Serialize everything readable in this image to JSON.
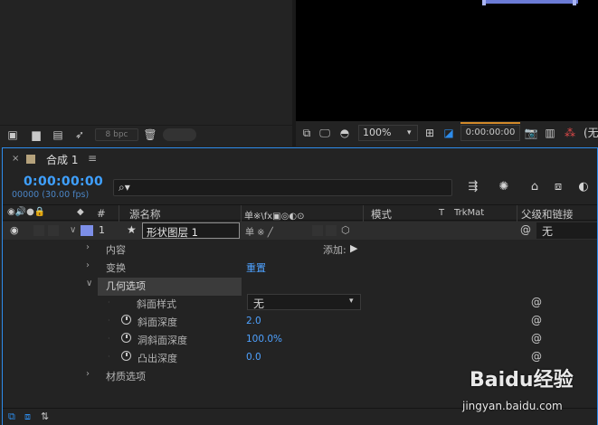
{
  "project_panel": {
    "bpc_label": "8 bpc"
  },
  "viewer_toolbar": {
    "zoom_value": "100%",
    "timecode": "0:00:00:00",
    "overflow_label": "(无"
  },
  "timeline": {
    "tab_title": "合成 1",
    "timecode": "0:00:00:00",
    "frames": "00000 (30.00 fps)",
    "search_placeholder": "",
    "columns": {
      "number": "#",
      "source_name": "源名称",
      "switches": "单※\\fx▣◎◐⊙",
      "mode": "模式",
      "t": "T",
      "trkmat": "TrkMat",
      "parent": "父级和链接"
    },
    "layer": {
      "index": "1",
      "name": "形状图层 1",
      "parent_value": "无"
    },
    "rows": {
      "content": "内容",
      "add_label": "添加:",
      "transform": "变换",
      "transform_reset": "重置",
      "geometry": "几何选项",
      "bevel_style": "斜面样式",
      "bevel_style_value": "无",
      "bevel_depth": "斜面深度",
      "bevel_depth_value": "2.0",
      "hole_bevel_depth": "洞斜面深度",
      "hole_bevel_depth_value": "100.0%",
      "extrusion_depth": "凸出深度",
      "extrusion_depth_value": "0.0",
      "material": "材质选项"
    }
  },
  "watermark": {
    "brand": "Baidu经验",
    "url": "jingyan.baidu.com"
  },
  "colors": {
    "accent_blue": "#2d8ceb",
    "timecode_blue": "#3fa0ff",
    "value_blue": "#4ea1ff",
    "layer_label_swatch": "#7d8fe8",
    "comp_swatch": "#b5a27c"
  }
}
